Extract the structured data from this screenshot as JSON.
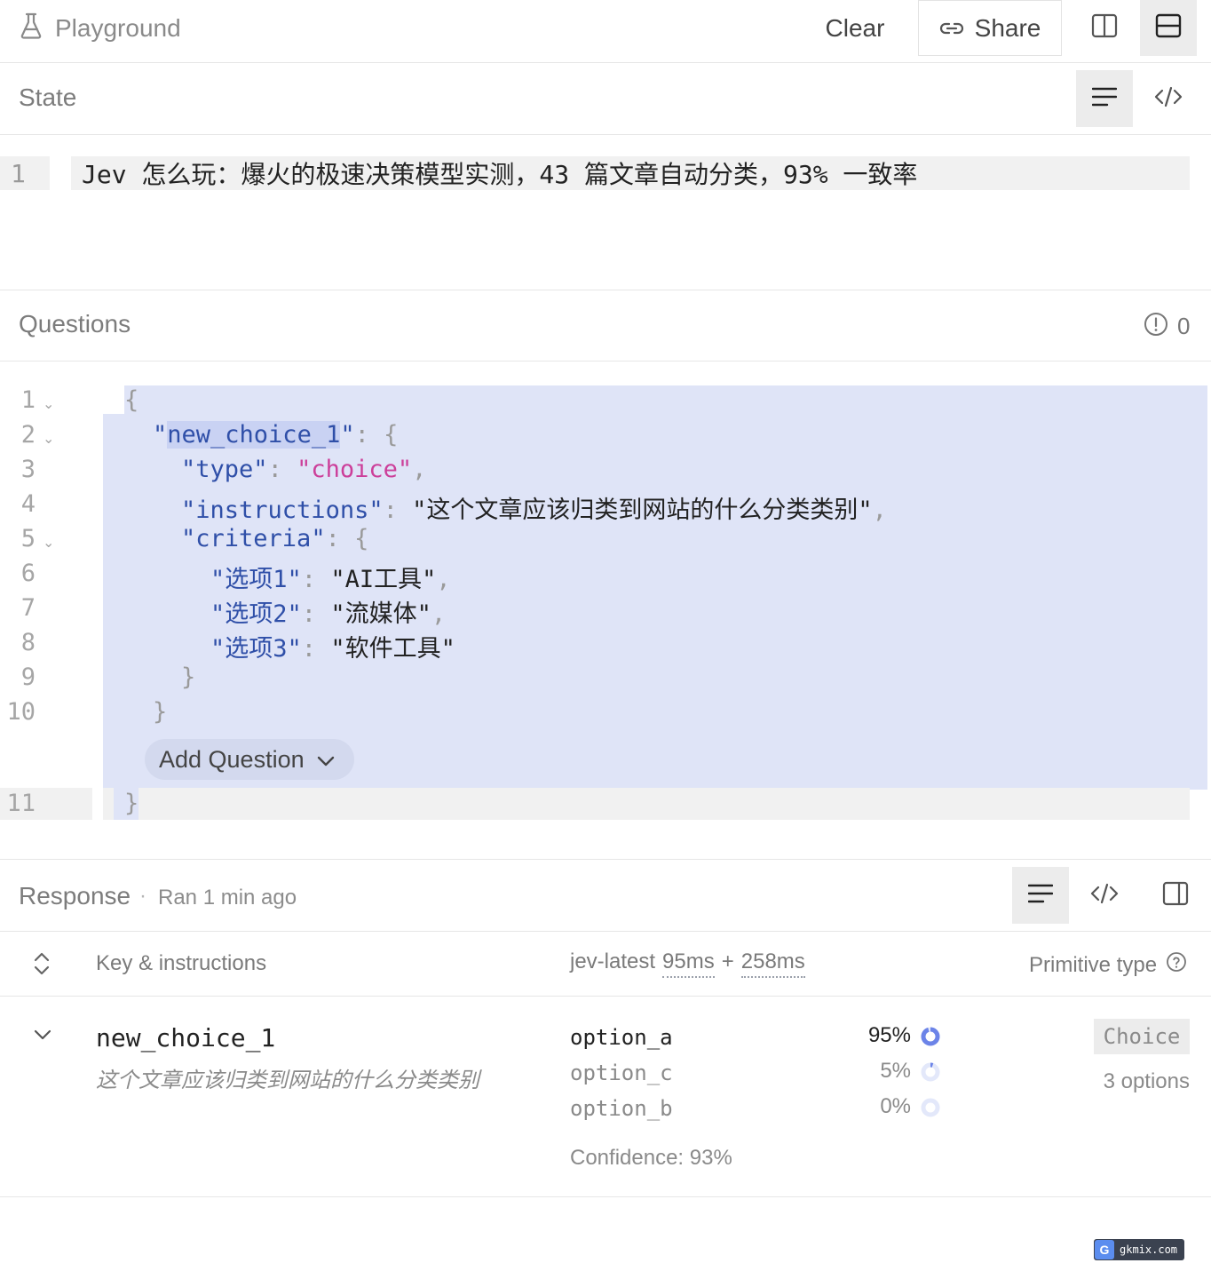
{
  "app": {
    "title": "Playground",
    "clear_label": "Clear",
    "share_label": "Share"
  },
  "state": {
    "title": "State",
    "line_number": "1",
    "line_text": "Jev 怎么玩：爆火的极速决策模型实测，43 篇文章自动分类，93% 一致率"
  },
  "questions": {
    "title": "Questions",
    "issue_count": "0",
    "add_question_label": "Add Question",
    "gutter": [
      "1",
      "2",
      "3",
      "4",
      "5",
      "6",
      "7",
      "8",
      "9",
      "10",
      "11"
    ],
    "code": {
      "open_brace": "{",
      "key_name": "new_choice_1",
      "type_key": "type",
      "type_value": "choice",
      "instructions_key": "instructions",
      "instructions_value": "这个文章应该归类到网站的什么分类类别",
      "criteria_key": "criteria",
      "opt1_key": "选项1",
      "opt1_value": "AI工具",
      "opt2_key": "选项2",
      "opt2_value": "流媒体",
      "opt3_key": "选项3",
      "opt3_value": "软件工具",
      "close_brace": "}"
    }
  },
  "response": {
    "title": "Response",
    "separator": "·",
    "ran_text": "Ran 1 min ago",
    "columns": {
      "key": "Key & instructions",
      "model": "jev-latest",
      "latency_1": "95ms",
      "plus": "+",
      "latency_2": "258ms",
      "type": "Primitive type"
    },
    "row": {
      "key": "new_choice_1",
      "instructions": "这个文章应该归类到网站的什么分类类别",
      "options": [
        {
          "label": "option_a",
          "percent": "95%",
          "fraction": 0.95
        },
        {
          "label": "option_c",
          "percent": "5%",
          "fraction": 0.05
        },
        {
          "label": "option_b",
          "percent": "0%",
          "fraction": 0.0
        }
      ],
      "confidence": "Confidence: 93%",
      "type_badge": "Choice",
      "options_count": "3 options"
    }
  },
  "watermark": {
    "badge": "G",
    "text": "gkmix.com"
  },
  "colors": {
    "accent": "#6c84e8",
    "selection": "#dfe4f7",
    "key_blue": "#2f4fa8",
    "string_pink": "#cc3f9a"
  }
}
